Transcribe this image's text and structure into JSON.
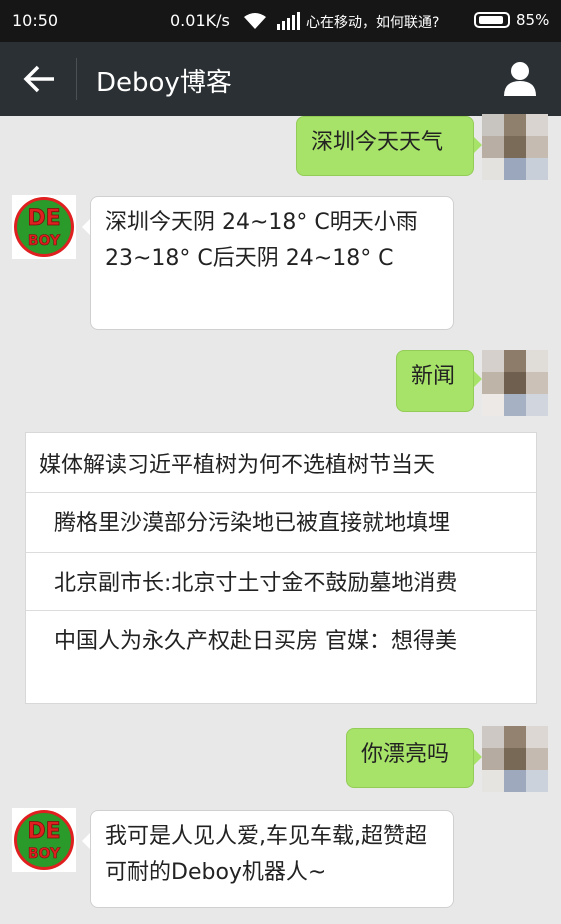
{
  "status": {
    "time": "10:50",
    "speed": "0.01K/s",
    "carrier": "心在移动，如何联通?",
    "battery": "85%"
  },
  "header": {
    "title": "Deboy博客",
    "back_icon": "back-arrow-icon",
    "user_icon": "person-icon"
  },
  "bot_logo": {
    "line1": "DE",
    "line2": "BOY"
  },
  "messages": [
    {
      "from": "user",
      "text": "深圳今天天气"
    },
    {
      "from": "bot",
      "text": "深圳今天阴 24~18° C明天小雨 23~18° C后天阴 24~18° C"
    },
    {
      "from": "user",
      "text": "新闻"
    },
    {
      "from": "user",
      "text": "你漂亮吗"
    },
    {
      "from": "bot",
      "text": "我可是人见人爱,车见车载,超赞超可耐的Deboy机器人~"
    }
  ],
  "news": {
    "headline": "媒体解读习近平植树为何不选植树节当天",
    "items": [
      "腾格里沙漠部分污染地已被直接就地填埋",
      "北京副市长:北京寸土寸金不鼓励墓地消费",
      "中国人为永久产权赴日买房 官媒：想得美"
    ]
  },
  "colors": {
    "green_bubble": "#a7e368",
    "header_bg": "#2b3034",
    "logo_red": "#e02020",
    "logo_green": "#2a9a2a"
  }
}
